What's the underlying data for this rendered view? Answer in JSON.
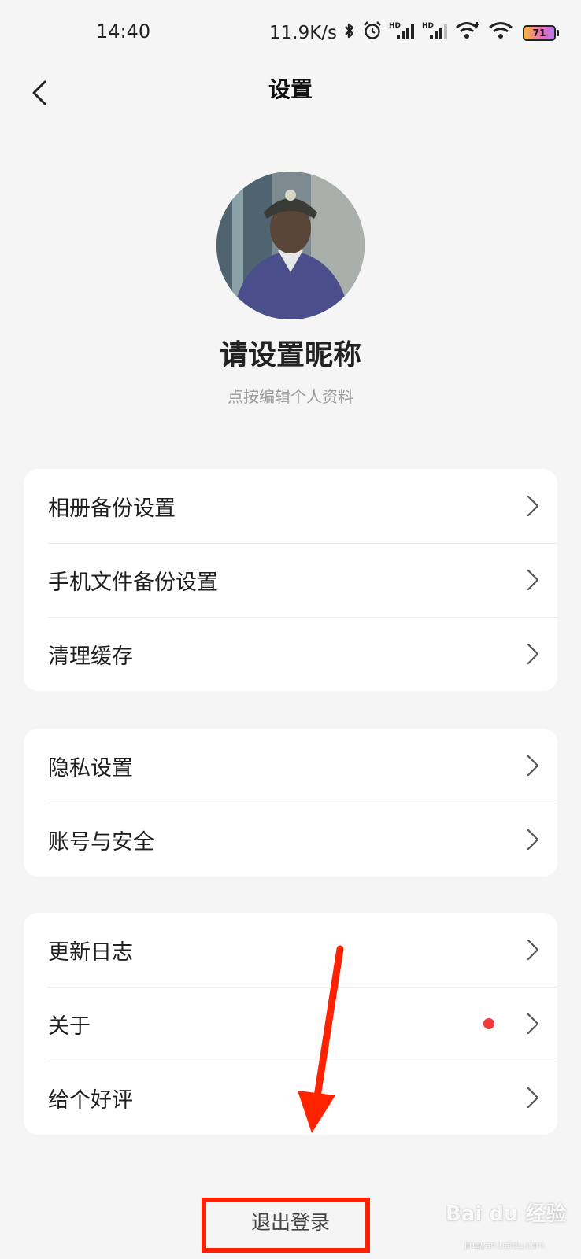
{
  "status_bar": {
    "time": "14:40",
    "network_speed": "11.9K/s",
    "battery_level": "71",
    "icons": [
      "bluetooth-icon",
      "alarm-icon",
      "hd-signal-icon",
      "hd-signal-icon",
      "wifi-icon",
      "wifi-icon",
      "battery-icon"
    ]
  },
  "header": {
    "title": "设置",
    "back_icon": "chevron-left-icon"
  },
  "profile": {
    "nickname": "请设置昵称",
    "hint": "点按编辑个人资料"
  },
  "groups": [
    {
      "items": [
        {
          "label": "相册备份设置"
        },
        {
          "label": "手机文件备份设置"
        },
        {
          "label": "清理缓存"
        }
      ]
    },
    {
      "items": [
        {
          "label": "隐私设置"
        },
        {
          "label": "账号与安全"
        }
      ]
    },
    {
      "items": [
        {
          "label": "更新日志"
        },
        {
          "label": "关于",
          "badge": "red-dot"
        },
        {
          "label": "给个好评"
        }
      ]
    }
  ],
  "logout_label": "退出登录",
  "watermark": {
    "brand": "Bai du 经验",
    "url": "jingyan.baidu.com"
  },
  "colors": {
    "background": "#f5f5f5",
    "card": "#ffffff",
    "badge": "#f23a3a",
    "annotation": "#ff2200"
  }
}
